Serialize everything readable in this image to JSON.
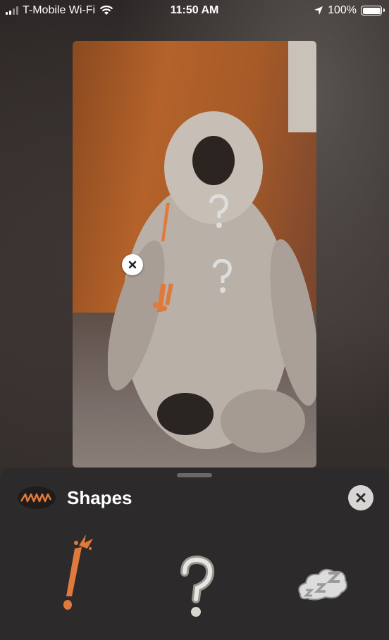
{
  "status_bar": {
    "carrier": "T-Mobile Wi-Fi",
    "time": "11:50 AM",
    "battery": "100%"
  },
  "sheet": {
    "title": "Shapes",
    "icon": "squiggle-icon",
    "stickers": [
      {
        "name": "exclamation-sticker"
      },
      {
        "name": "question-mark-sticker"
      },
      {
        "name": "zzz-sticker"
      }
    ]
  },
  "colors": {
    "accent_orange": "#e07a3c",
    "sheet_bg": "#2c2a2a"
  }
}
